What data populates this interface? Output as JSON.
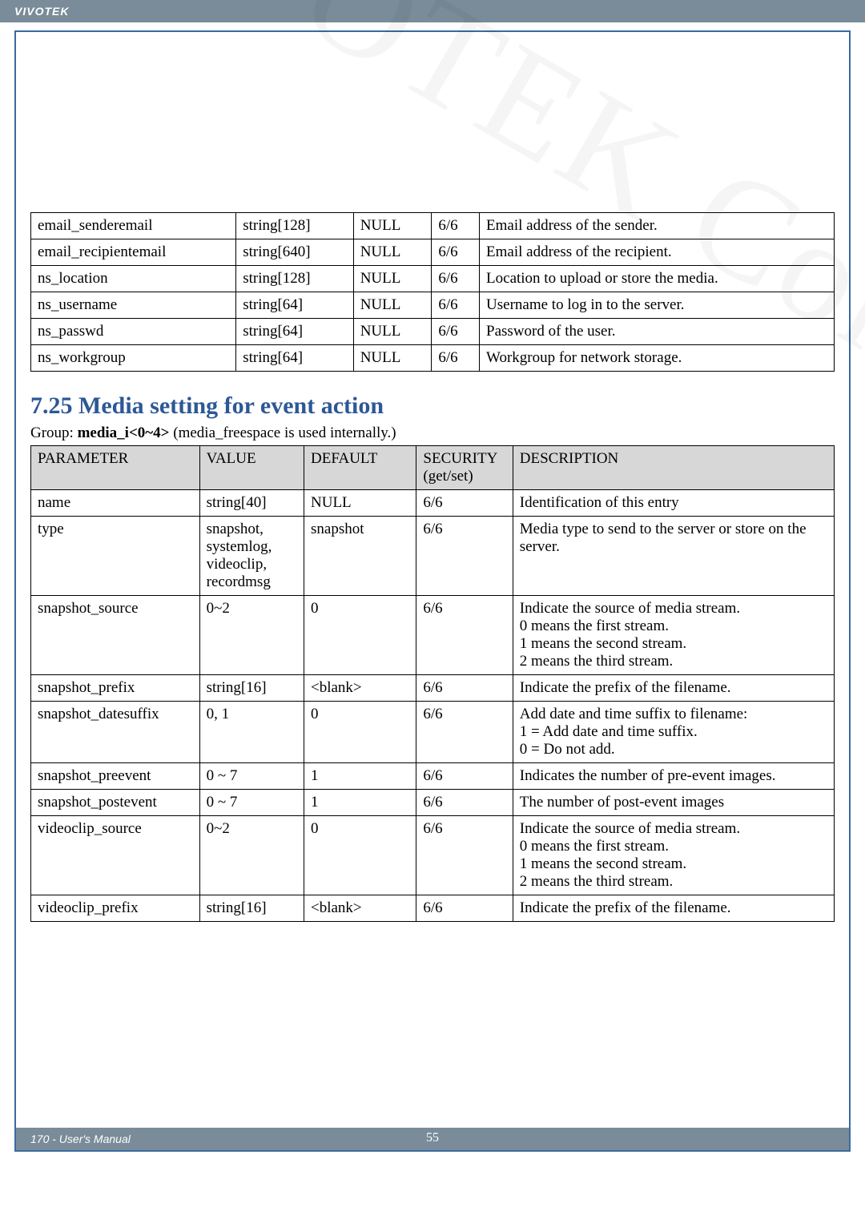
{
  "brand": "VIVOTEK",
  "watermark_text": "VIVOTEK Confidential",
  "footer_left": "170 - User's Manual",
  "footer_center": "55",
  "table1": {
    "rows": [
      {
        "p": "email_senderemail",
        "v": "string[128]",
        "d": "NULL",
        "s": "6/6",
        "desc": "Email address of the sender."
      },
      {
        "p": "email_recipientemail",
        "v": "string[640]",
        "d": "NULL",
        "s": "6/6",
        "desc": "Email address of the recipient."
      },
      {
        "p": "ns_location",
        "v": "string[128]",
        "d": "NULL",
        "s": "6/6",
        "desc": "Location to upload or store the media."
      },
      {
        "p": "ns_username",
        "v": "string[64]",
        "d": "NULL",
        "s": "6/6",
        "desc": "Username to log in to the server."
      },
      {
        "p": "ns_passwd",
        "v": "string[64]",
        "d": "NULL",
        "s": "6/6",
        "desc": "Password of the user."
      },
      {
        "p": "ns_workgroup",
        "v": "string[64]",
        "d": "NULL",
        "s": "6/6",
        "desc": "Workgroup for network storage."
      }
    ]
  },
  "section_title": "7.25 Media setting for event action",
  "group_note_prefix": "Group: ",
  "group_note_bold": "media_i<0~4>",
  "group_note_suffix": " (media_freespace is used internally.)",
  "table2": {
    "head": {
      "p": "PARAMETER",
      "v": "VALUE",
      "d": "DEFAULT",
      "s": "SECURITY (get/set)",
      "desc": "DESCRIPTION"
    },
    "rows": [
      {
        "p": "name",
        "v": "string[40]",
        "d": "NULL",
        "s": "6/6",
        "desc": "Identification of this entry"
      },
      {
        "p": "type",
        "v": "snapshot, systemlog, videoclip, recordmsg",
        "d": "snapshot",
        "s": "6/6",
        "desc": "Media type to send to the server or store on the server."
      },
      {
        "p": "snapshot_source",
        "v": "0~2",
        "d": "0",
        "s": "6/6",
        "desc": "Indicate the source of media stream.\n0 means the first stream.\n1 means the second stream.\n2 means the third stream."
      },
      {
        "p": "snapshot_prefix",
        "v": "string[16]",
        "d": "<blank>",
        "s": "6/6",
        "desc": "Indicate the prefix of the filename."
      },
      {
        "p": "snapshot_datesuffix",
        "v": "0, 1",
        "d": "0",
        "s": "6/6",
        "desc": "Add date and time suffix to filename:\n1 = Add date and time suffix.\n0 = Do not add."
      },
      {
        "p": "snapshot_preevent",
        "v": "0 ~ 7",
        "d": "1",
        "s": "6/6",
        "desc": "Indicates the number of pre-event images."
      },
      {
        "p": "snapshot_postevent",
        "v": "0 ~ 7",
        "d": "1",
        "s": "6/6",
        "desc": "The number of post-event images"
      },
      {
        "p": "videoclip_source",
        "v": "0~2",
        "d": "0",
        "s": "6/6",
        "desc": "Indicate the source of media stream.\n0 means the first stream.\n1 means the second stream.\n2 means the third stream."
      },
      {
        "p": "videoclip_prefix",
        "v": "string[16]",
        "d": "<blank>",
        "s": "6/6",
        "desc": "Indicate the prefix of the filename."
      }
    ]
  }
}
